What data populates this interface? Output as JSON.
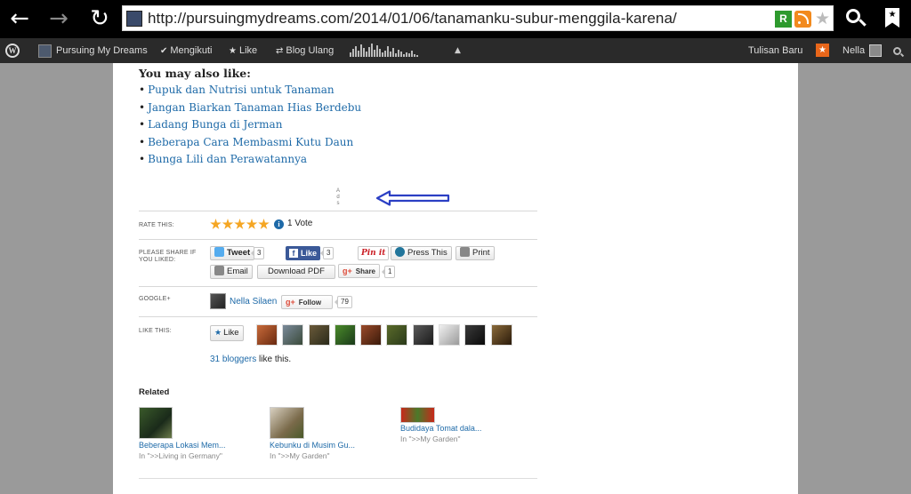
{
  "browser": {
    "url": "http://pursuingmydreams.com/2014/01/06/tanamanku-subur-menggila-karena/",
    "icons": [
      "back-arrow-icon",
      "forward-arrow-icon",
      "reload-icon",
      "search-icon",
      "bookmark-star-icon"
    ],
    "extension_label": "R"
  },
  "admin_bar": {
    "site_name": "Pursuing My Dreams",
    "follow_label": "Mengikuti",
    "like_label": "Like",
    "reblog_label": "Blog Ulang",
    "new_post_label": "Tulisan Baru",
    "user_name": "Nella"
  },
  "post": {
    "also_like_title": "You may also like",
    "also_like_colon": ":",
    "also_like": [
      "Pupuk dan Nutrisi untuk Tanaman",
      "Jangan Biarkan Tanaman Hias Berdebu",
      "Ladang Bunga di Jerman",
      "Beberapa Cara Membasmi Kutu Daun",
      "Bunga Lili dan Perawatannya"
    ],
    "ad_letters": [
      "A",
      "d",
      "s"
    ],
    "rating": {
      "label": "RATE THIS:",
      "stars": 5,
      "votes": "1 Vote"
    },
    "share": {
      "label_line1": "PLEASE SHARE IF",
      "label_line2": "YOU LIKED:",
      "tweet": "Tweet",
      "tweet_count": "3",
      "fb_like": "Like",
      "fb_count": "3",
      "pinit": "Pin it",
      "press_this": "Press This",
      "print": "Print",
      "email": "Email",
      "download_pdf": "Download PDF",
      "gplus_share": "Share",
      "gplus_count": "1"
    },
    "google_plus": {
      "label": "GOOGLE+",
      "name": "Nella Silaen",
      "follow": "Follow",
      "count": "79"
    },
    "likes": {
      "label": "LIKE THIS:",
      "button": "Like",
      "bloggers_link": "31 bloggers",
      "bloggers_rest": " like this."
    },
    "related": {
      "title": "Related",
      "items": [
        {
          "title": "Beberapa Lokasi Mem...",
          "category": "In \">>Living in Germany\""
        },
        {
          "title": "Kebunku di Musim Gu...",
          "category": "In \">>My Garden\""
        },
        {
          "title": "Budidaya Tomat dala...",
          "category": "In \">>My Garden\""
        }
      ]
    },
    "colors": {
      "link": "#1e6aa8",
      "arrow": "#2b3fc4",
      "admin_bar": "#2a2a2a",
      "star": "#f5a623",
      "facebook": "#3b5998",
      "pinterest": "#cb2027",
      "gplus": "#dd4b39"
    }
  }
}
